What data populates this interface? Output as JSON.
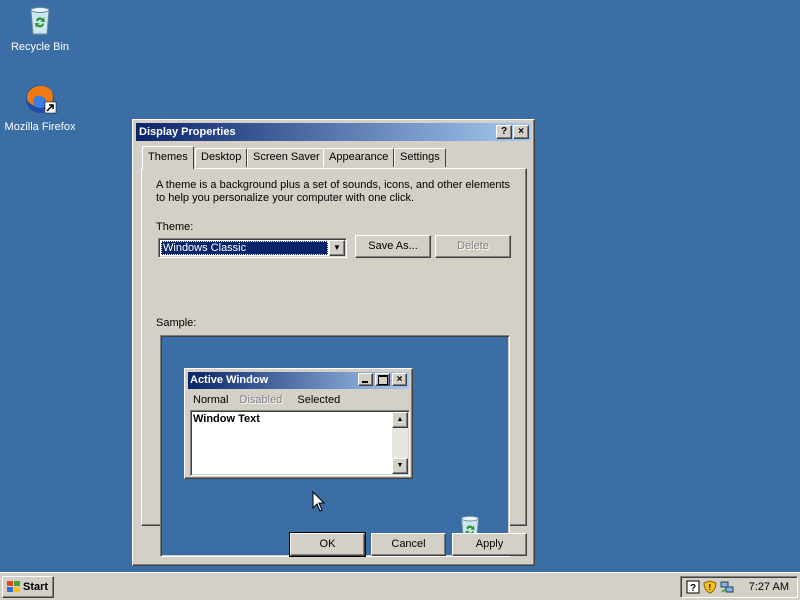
{
  "desktop": {
    "icons": [
      {
        "label": "Recycle Bin",
        "icon": "recycle-bin-icon"
      },
      {
        "label": "Mozilla Firefox",
        "icon": "firefox-icon"
      }
    ]
  },
  "dialog": {
    "title": "Display Properties",
    "title_buttons": [
      "?",
      "×"
    ],
    "tabs": [
      "Themes",
      "Desktop",
      "Screen Saver",
      "Appearance",
      "Settings"
    ],
    "active_tab": "Themes",
    "description": "A theme is a background plus a set of sounds, icons, and other elements to help you personalize your computer with one click.",
    "theme_label": "Theme:",
    "theme_value": "Windows Classic",
    "save_as_label": "Save As...",
    "delete_label": "Delete",
    "sample_label": "Sample:",
    "sample": {
      "window_title": "Active Window",
      "menu": {
        "normal": "Normal",
        "disabled": "Disabled",
        "selected": "Selected"
      },
      "window_text": "Window Text"
    },
    "ok_label": "OK",
    "cancel_label": "Cancel",
    "apply_label": "Apply"
  },
  "taskbar": {
    "start_label": "Start",
    "clock": "7:27 AM"
  },
  "colors": {
    "desktop": "#3a6ea5",
    "face": "#d4d0c8",
    "title_active_start": "#0a246a",
    "title_active_end": "#a6caf0"
  }
}
